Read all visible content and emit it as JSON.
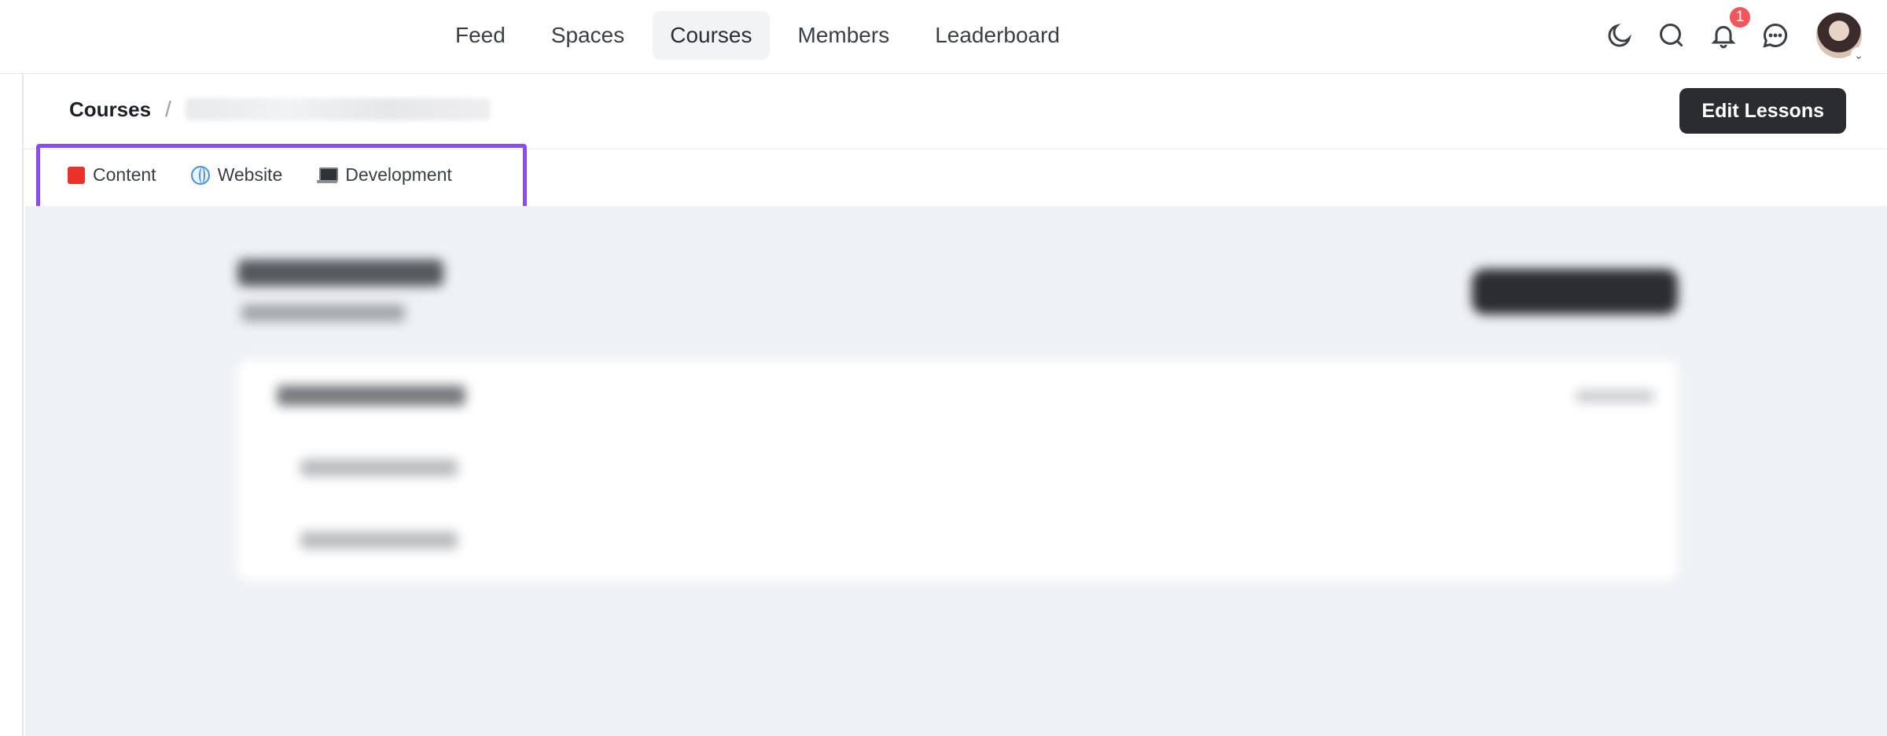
{
  "nav": {
    "items": [
      {
        "label": "Feed",
        "active": false
      },
      {
        "label": "Spaces",
        "active": false
      },
      {
        "label": "Courses",
        "active": true
      },
      {
        "label": "Members",
        "active": false
      },
      {
        "label": "Leaderboard",
        "active": false
      }
    ]
  },
  "header_actions": {
    "icons": [
      "moon-icon",
      "search-icon",
      "bell-icon",
      "chat-icon"
    ],
    "notification_count": "1"
  },
  "breadcrumb": {
    "root": "Courses",
    "separator": "/"
  },
  "toolbar": {
    "edit_label": "Edit Lessons"
  },
  "tags": [
    {
      "label": "Content",
      "icon": "red-square-icon"
    },
    {
      "label": "Website",
      "icon": "globe-icon"
    },
    {
      "label": "Development",
      "icon": "laptop-icon"
    }
  ],
  "colors": {
    "accent_highlight": "#8a4cf0",
    "badge": "#f2555a",
    "primary_button": "#2a2c30",
    "content_background": "#eff2f5"
  }
}
